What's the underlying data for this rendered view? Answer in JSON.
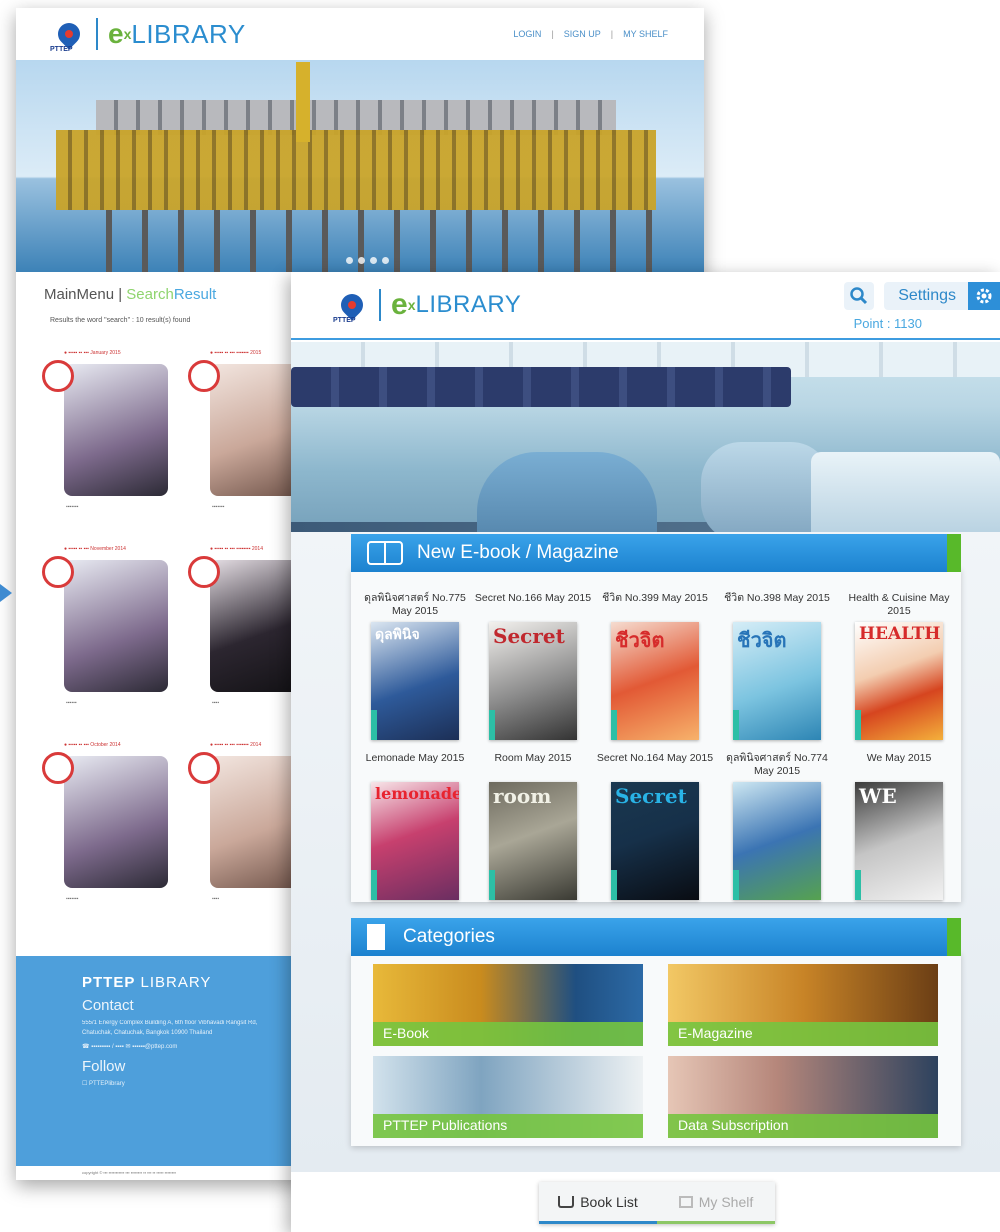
{
  "back_screen": {
    "logo": {
      "company": "PTTEP",
      "e": "e",
      "x": "x",
      "lib": "LIBRARY"
    },
    "nav": [
      "LOGIN",
      "SIGN UP",
      "MY SHELF"
    ],
    "menu": {
      "main": "MainMenu",
      "sep": "|",
      "search_a": "Search",
      "search_b": "Result"
    },
    "result_text": "Results the word \"search\" : 10 result(s) found",
    "books": [
      {
        "caption": "●  ▪▪▪▪▪ ▪▪ ▪▪▪ January 2015",
        "tag": "▪▪▪▪▪▪▪"
      },
      {
        "caption": "●  ▪▪▪▪▪ ▪▪ ▪▪▪ ▪▪▪▪▪▪▪ 2015",
        "tag": "▪▪▪▪▪▪▪"
      },
      {
        "caption": "●  ▪▪▪▪▪ ▪▪ ▪▪▪ November 2014",
        "tag": "▪▪▪▪▪▪"
      },
      {
        "caption": "●  ▪▪▪▪▪ ▪▪ ▪▪▪ ▪▪▪▪▪▪▪▪ 2014",
        "tag": "▪▪▪▪"
      },
      {
        "caption": "●  ▪▪▪▪▪ ▪▪ ▪▪▪ October 2014",
        "tag": "▪▪▪▪▪▪▪"
      },
      {
        "caption": "●  ▪▪▪▪▪ ▪▪ ▪▪▪ ▪▪▪▪▪▪▪ 2014",
        "tag": "▪▪▪▪"
      }
    ],
    "footer": {
      "brand_bold": "PTTEP",
      "brand_light": "LIBRARY",
      "contact_title": "Contact",
      "address": "555/1 Energy Complex Building A, 6th floor Vibhavadi Rangsit Rd, Chatuchak, Chatuchak, Bangkok 10900 Thailand",
      "contact_lines": "☎ ▪▪▪▪▪▪▪▪▪ / ▪▪▪▪    ✉ ▪▪▪▪▪▪@pttep.com",
      "follow_title": "Follow",
      "follow_line": "☐ PTTEPlibrary",
      "copyright": "copyright © ▪▪▪ ▪▪▪▪▪▪▪▪▪▪▪ ▪▪▪ ▪▪▪▪▪▪▪▪ ▪▪ ▪▪▪ ▪▪ ▪▪▪▪▪ ▪▪▪▪▪▪▪▪"
    }
  },
  "front_screen": {
    "logo": {
      "company": "PTTEP",
      "e": "e",
      "x": "x",
      "lib": "LIBRARY"
    },
    "settings_label": "Settings",
    "points": "Point : 1130",
    "new_section_title": "New E-book / Magazine",
    "magazines": [
      {
        "title": "ดุลพินิจศาสตร์ No.775 May 2015",
        "cover_text": "ดุลพินิจ"
      },
      {
        "title": "Secret  No.166 May 2015",
        "cover_text": "Secret"
      },
      {
        "title": "ชีวิต  No.399 May 2015",
        "cover_text": "ชีวจิต"
      },
      {
        "title": "ชีวิต  No.398  May 2015",
        "cover_text": "ชีวจิต"
      },
      {
        "title": "Health & Cuisine May 2015",
        "cover_text": "HEALTH"
      },
      {
        "title": "Lemonade May 2015",
        "cover_text": "lemonade"
      },
      {
        "title": "Room  May 2015",
        "cover_text": "room"
      },
      {
        "title": "Secret No.164  May 2015",
        "cover_text": "Secret"
      },
      {
        "title": "ดุลพินิจศาสตร์ No.774 May 2015",
        "cover_text": ""
      },
      {
        "title": "We  May 2015",
        "cover_text": "WE"
      }
    ],
    "categories_title": "Categories",
    "categories": [
      "E-Book",
      "E-Magazine",
      "PTTEP Publications",
      "Data Subscription"
    ],
    "tabs": {
      "book_list": "Book List",
      "my_shelf": "My Shelf"
    }
  },
  "colors": {
    "brand_blue": "#2d88c9",
    "brand_green": "#6ab23d",
    "ribbon_blue": "#1c82cf"
  }
}
